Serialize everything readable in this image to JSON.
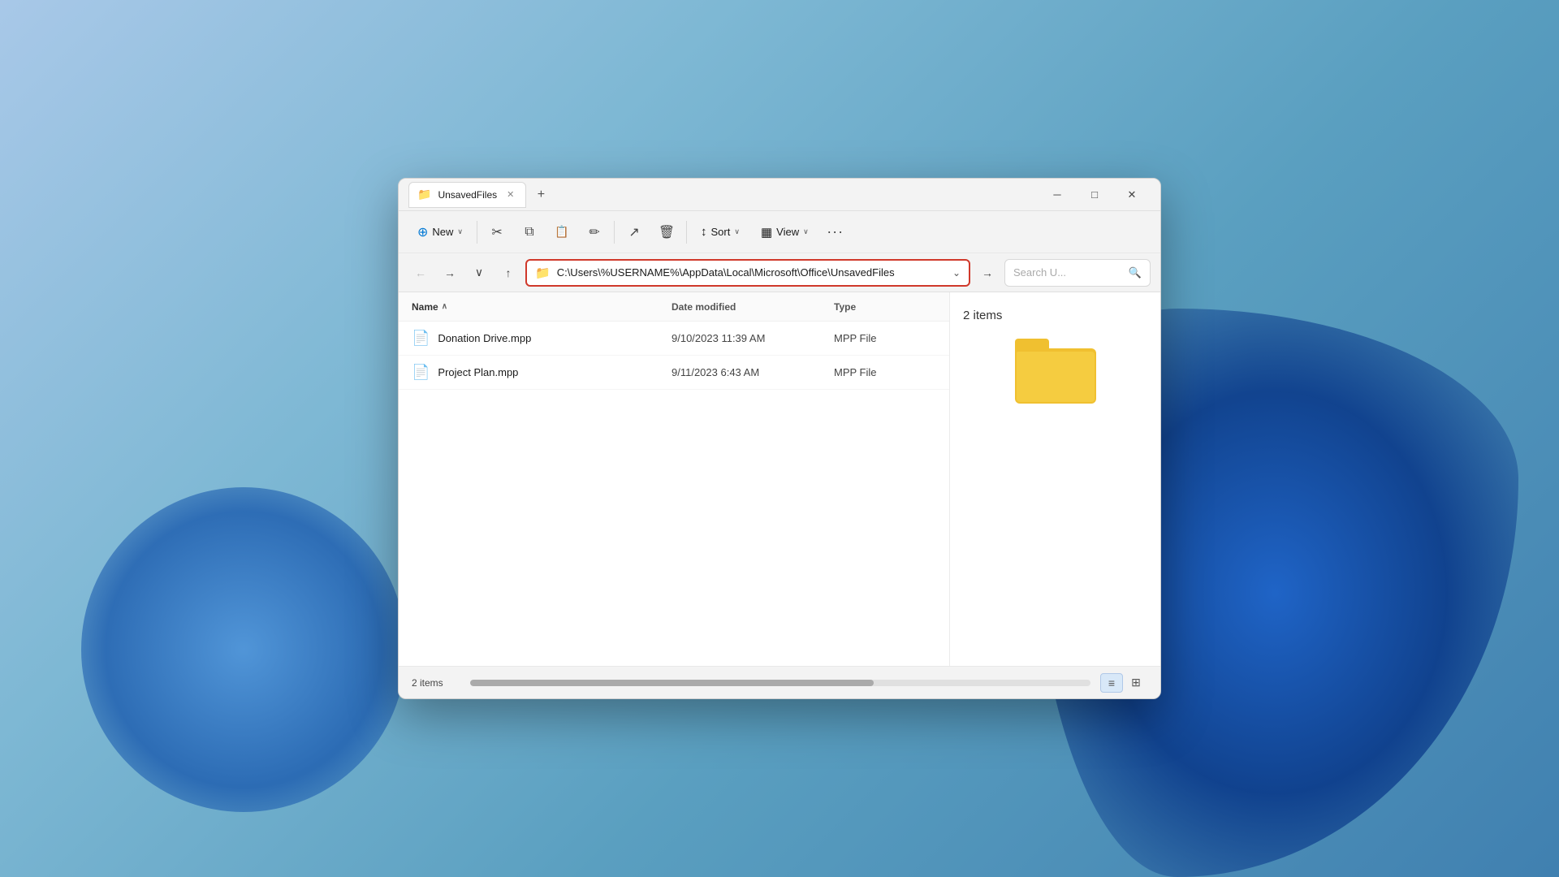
{
  "background": {
    "color_start": "#a8c8e8",
    "color_end": "#4080b0"
  },
  "window": {
    "title": "UnsavedFiles",
    "tab_label": "UnsavedFiles",
    "close_label": "✕",
    "minimize_label": "─",
    "maximize_label": "□",
    "new_tab_label": "+"
  },
  "toolbar": {
    "new_label": "New",
    "new_chevron": "∨",
    "sort_label": "Sort",
    "sort_chevron": "∨",
    "view_label": "View",
    "view_chevron": "∨",
    "more_label": "···",
    "cut_icon": "✂",
    "copy_icon": "⧉",
    "paste_icon": "📋",
    "rename_icon": "✏",
    "share_icon": "↗",
    "delete_icon": "🗑"
  },
  "address_bar": {
    "path": "C:\\Users\\%USERNAME%\\AppData\\Local\\Microsoft\\Office\\UnsavedFiles",
    "dropdown_icon": "⌄",
    "go_icon": "→",
    "search_placeholder": "Search U...",
    "search_icon": "🔍"
  },
  "navigation": {
    "back_icon": "←",
    "forward_icon": "→",
    "recent_icon": "∨",
    "up_icon": "↑"
  },
  "file_list": {
    "columns": {
      "name": "Name",
      "name_sort_icon": "∧",
      "date_modified": "Date modified",
      "type": "Type"
    },
    "files": [
      {
        "name": "Donation Drive.mpp",
        "date_modified": "9/10/2023 11:39 AM",
        "type": "MPP File"
      },
      {
        "name": "Project Plan.mpp",
        "date_modified": "9/11/2023 6:43 AM",
        "type": "MPP File"
      }
    ]
  },
  "preview": {
    "item_count": "2 items"
  },
  "status_bar": {
    "item_count": "2 items",
    "list_view_icon": "≡",
    "grid_view_icon": "⊞"
  }
}
